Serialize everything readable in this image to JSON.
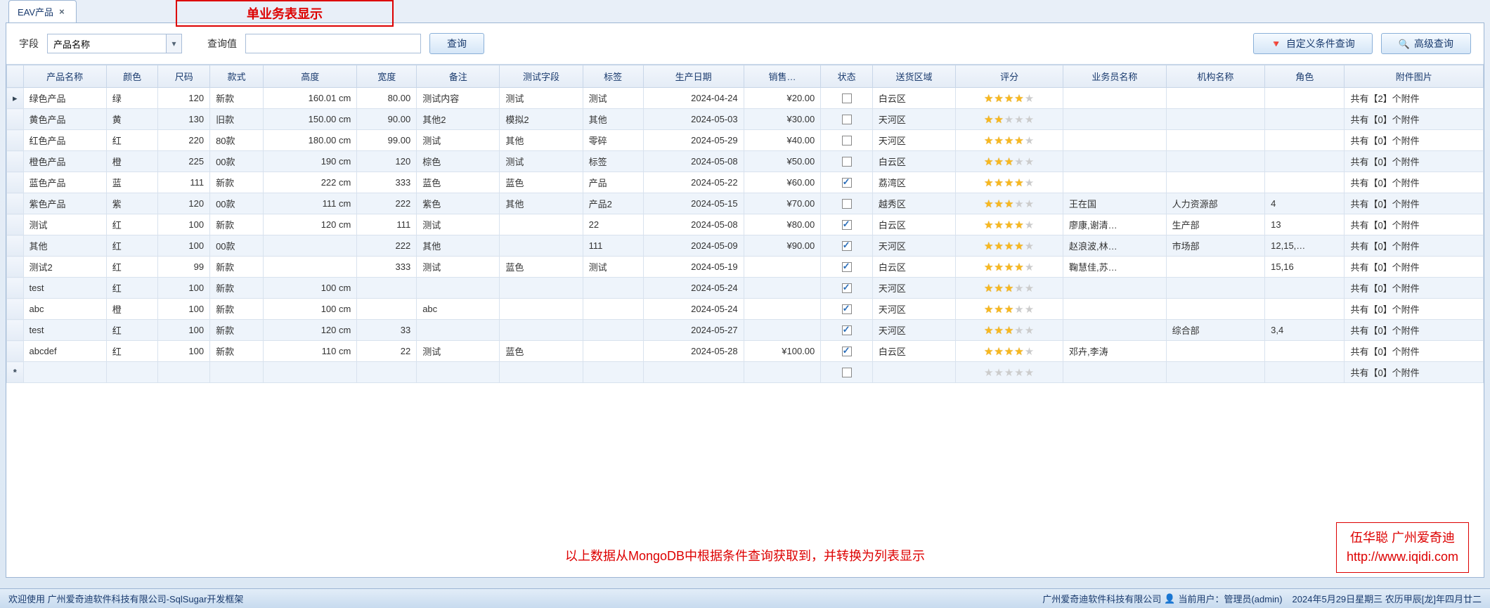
{
  "tab": {
    "label": "EAV产品"
  },
  "red_annotation": "单业务表显示",
  "toolbar": {
    "field_label": "字段",
    "field_value": "产品名称",
    "value_label": "查询值",
    "value_input": "",
    "search_btn": "查询",
    "custom_btn": "自定义条件查询",
    "advanced_btn": "高级查询"
  },
  "columns": [
    "产品名称",
    "颜色",
    "尺码",
    "款式",
    "高度",
    "宽度",
    "备注",
    "测试字段",
    "标签",
    "生产日期",
    "销售…",
    "状态",
    "送货区域",
    "评分",
    "业务员名称",
    "机构名称",
    "角色",
    "附件图片"
  ],
  "rows": [
    {
      "ind": "active",
      "name": "绿色产品",
      "color": "绿",
      "size": "120",
      "style": "新款",
      "height": "160.01 cm",
      "width": "80.00",
      "remark": "测试内容",
      "testf": "测试",
      "tag": "测试",
      "date": "2024-04-24",
      "price": "¥20.00",
      "state": false,
      "area": "白云区",
      "rating": 4,
      "sales": "",
      "org": "",
      "role": "",
      "attach": "共有【2】个附件"
    },
    {
      "ind": "",
      "name": "黄色产品",
      "color": "黄",
      "size": "130",
      "style": "旧款",
      "height": "150.00 cm",
      "width": "90.00",
      "remark": "其他2",
      "testf": "模拟2",
      "tag": "其他",
      "date": "2024-05-03",
      "price": "¥30.00",
      "state": false,
      "area": "天河区",
      "rating": 2,
      "sales": "",
      "org": "",
      "role": "",
      "attach": "共有【0】个附件"
    },
    {
      "ind": "",
      "name": "红色产品",
      "color": "红",
      "size": "220",
      "style": "80款",
      "height": "180.00 cm",
      "width": "99.00",
      "remark": "测试",
      "testf": "其他",
      "tag": "零碎",
      "date": "2024-05-29",
      "price": "¥40.00",
      "state": false,
      "area": "天河区",
      "rating": 4,
      "sales": "",
      "org": "",
      "role": "",
      "attach": "共有【0】个附件"
    },
    {
      "ind": "",
      "name": "橙色产品",
      "color": "橙",
      "size": "225",
      "style": "00款",
      "height": "190 cm",
      "width": "120",
      "remark": "棕色",
      "testf": "测试",
      "tag": "标签",
      "date": "2024-05-08",
      "price": "¥50.00",
      "state": false,
      "area": "白云区",
      "rating": 3,
      "sales": "",
      "org": "",
      "role": "",
      "attach": "共有【0】个附件"
    },
    {
      "ind": "",
      "name": "蓝色产品",
      "color": "蓝",
      "size": "111",
      "style": "新款",
      "height": "222 cm",
      "width": "333",
      "remark": "蓝色",
      "testf": "蓝色",
      "tag": "产品",
      "date": "2024-05-22",
      "price": "¥60.00",
      "state": true,
      "area": "荔湾区",
      "rating": 4,
      "sales": "",
      "org": "",
      "role": "",
      "attach": "共有【0】个附件"
    },
    {
      "ind": "",
      "name": "紫色产品",
      "color": "紫",
      "size": "120",
      "style": "00款",
      "height": "111 cm",
      "width": "222",
      "remark": "紫色",
      "testf": "其他",
      "tag": "产品2",
      "date": "2024-05-15",
      "price": "¥70.00",
      "state": false,
      "area": "越秀区",
      "rating": 3,
      "sales": "王在国",
      "org": "人力资源部",
      "role": "4",
      "attach": "共有【0】个附件"
    },
    {
      "ind": "",
      "name": "测试",
      "color": "红",
      "size": "100",
      "style": "新款",
      "height": "120 cm",
      "width": "111",
      "remark": "测试",
      "testf": "",
      "tag": "22",
      "date": "2024-05-08",
      "price": "¥80.00",
      "state": true,
      "area": "白云区",
      "rating": 4,
      "sales": "廖康,谢清…",
      "org": "生产部",
      "role": "13",
      "attach": "共有【0】个附件"
    },
    {
      "ind": "",
      "name": "其他",
      "color": "红",
      "size": "100",
      "style": "00款",
      "height": "",
      "width": "222",
      "remark": "其他",
      "testf": "",
      "tag": "111",
      "date": "2024-05-09",
      "price": "¥90.00",
      "state": true,
      "area": "天河区",
      "rating": 4,
      "sales": "赵浪波,林…",
      "org": "市场部",
      "role": "12,15,…",
      "attach": "共有【0】个附件"
    },
    {
      "ind": "",
      "name": "测试2",
      "color": "红",
      "size": "99",
      "style": "新款",
      "height": "",
      "width": "333",
      "remark": "测试",
      "testf": "蓝色",
      "tag": "测试",
      "date": "2024-05-19",
      "price": "",
      "state": true,
      "area": "白云区",
      "rating": 4,
      "sales": "鞠慧佳,苏…",
      "org": "",
      "role": "15,16",
      "attach": "共有【0】个附件"
    },
    {
      "ind": "",
      "name": "test",
      "color": "红",
      "size": "100",
      "style": "新款",
      "height": "100 cm",
      "width": "",
      "remark": "",
      "testf": "",
      "tag": "",
      "date": "2024-05-24",
      "price": "",
      "state": true,
      "area": "天河区",
      "rating": 3,
      "sales": "",
      "org": "",
      "role": "",
      "attach": "共有【0】个附件"
    },
    {
      "ind": "",
      "name": "abc",
      "color": "橙",
      "size": "100",
      "style": "新款",
      "height": "100 cm",
      "width": "",
      "remark": "abc",
      "testf": "",
      "tag": "",
      "date": "2024-05-24",
      "price": "",
      "state": true,
      "area": "天河区",
      "rating": 3,
      "sales": "",
      "org": "",
      "role": "",
      "attach": "共有【0】个附件"
    },
    {
      "ind": "",
      "name": "test",
      "color": "红",
      "size": "100",
      "style": "新款",
      "height": "120 cm",
      "width": "33",
      "remark": "",
      "testf": "",
      "tag": "",
      "date": "2024-05-27",
      "price": "",
      "state": true,
      "area": "天河区",
      "rating": 3,
      "sales": "",
      "org": "综合部",
      "role": "3,4",
      "attach": "共有【0】个附件"
    },
    {
      "ind": "",
      "name": "abcdef",
      "color": "红",
      "size": "100",
      "style": "新款",
      "height": "110 cm",
      "width": "22",
      "remark": "测试",
      "testf": "蓝色",
      "tag": "",
      "date": "2024-05-28",
      "price": "¥100.00",
      "state": true,
      "area": "白云区",
      "rating": 4,
      "sales": "邓卉,李涛",
      "org": "",
      "role": "",
      "attach": "共有【0】个附件"
    },
    {
      "ind": "new",
      "name": "",
      "color": "",
      "size": "",
      "style": "",
      "height": "",
      "width": "",
      "remark": "",
      "testf": "",
      "tag": "",
      "date": "",
      "price": "",
      "state": false,
      "area": "",
      "rating": 0,
      "sales": "",
      "org": "",
      "role": "",
      "attach": "共有【0】个附件"
    }
  ],
  "footnote": "以上数据从MongoDB中根据条件查询获取到，并转换为列表显示",
  "watermark": {
    "line1": "伍华聪 广州爱奇迪",
    "line2": "http://www.iqidi.com"
  },
  "statusbar": {
    "welcome": "欢迎使用 广州爱奇迪软件科技有限公司-SqlSugar开发框架",
    "company": "广州爱奇迪软件科技有限公司",
    "user_label": "当前用户：",
    "user_value": "管理员(admin)",
    "date": "2024年5月29日星期三 农历甲辰[龙]年四月廿二"
  }
}
